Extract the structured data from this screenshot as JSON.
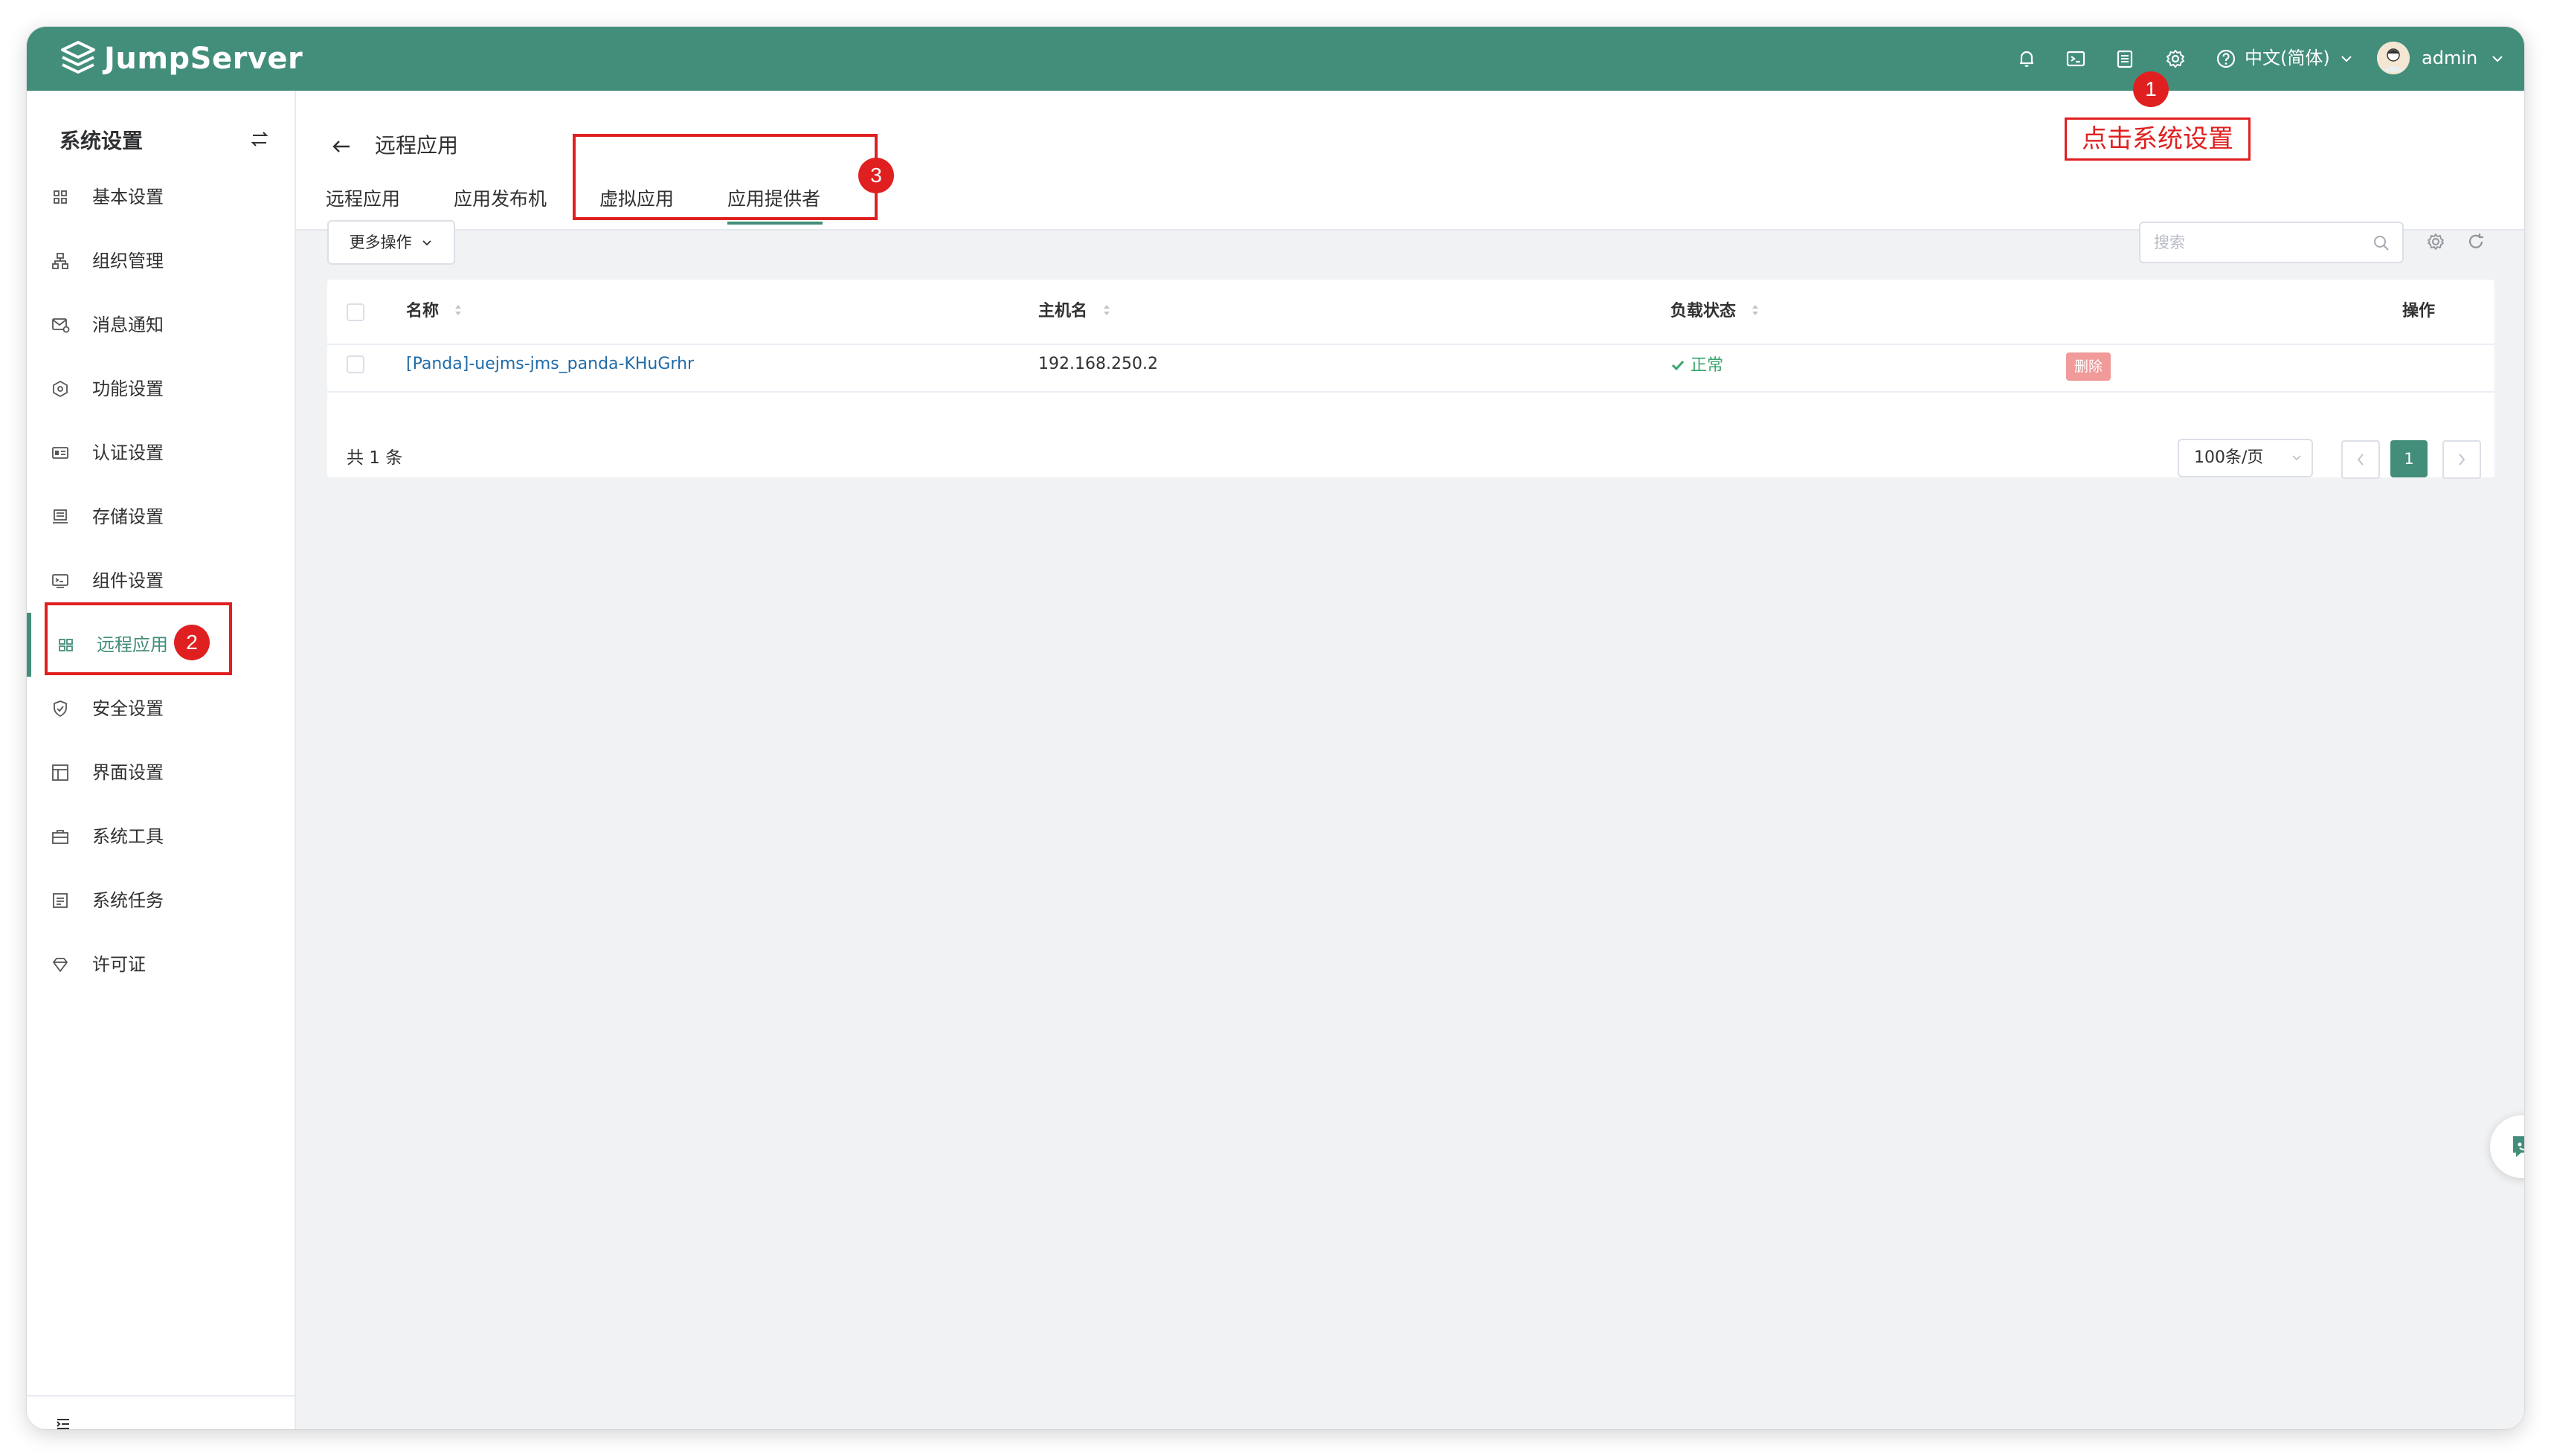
{
  "header": {
    "brand": "JumpServer",
    "language": "中文(简体)",
    "user": "admin",
    "icons": [
      "bell-icon",
      "terminal-icon",
      "document-icon",
      "gear-icon",
      "help-icon"
    ],
    "color": "#438e7b"
  },
  "sidebar": {
    "title": "系统设置",
    "items": [
      {
        "label": "基本设置",
        "icon": "grid-icon"
      },
      {
        "label": "组织管理",
        "icon": "org-icon"
      },
      {
        "label": "消息通知",
        "icon": "message-icon"
      },
      {
        "label": "功能设置",
        "icon": "feature-icon"
      },
      {
        "label": "认证设置",
        "icon": "id-card-icon"
      },
      {
        "label": "存储设置",
        "icon": "storage-icon"
      },
      {
        "label": "组件设置",
        "icon": "component-icon"
      },
      {
        "label": "远程应用",
        "icon": "app-grid-icon",
        "active": true
      },
      {
        "label": "安全设置",
        "icon": "shield-icon"
      },
      {
        "label": "界面设置",
        "icon": "layout-icon"
      },
      {
        "label": "系统工具",
        "icon": "toolbox-icon"
      },
      {
        "label": "系统任务",
        "icon": "task-icon"
      },
      {
        "label": "许可证",
        "icon": "diamond-icon"
      }
    ]
  },
  "page": {
    "title": "远程应用",
    "tabs": [
      "远程应用",
      "应用发布机",
      "虚拟应用",
      "应用提供者"
    ],
    "active_tab": "应用提供者"
  },
  "annotations": {
    "callout": "点击系统设置",
    "badges": [
      "1",
      "2",
      "3"
    ]
  },
  "toolbar": {
    "more_actions": "更多操作",
    "search_placeholder": "搜索"
  },
  "table": {
    "columns": [
      "名称",
      "主机名",
      "负载状态",
      "操作"
    ],
    "rows": [
      {
        "name": "[Panda]-uejms-jms_panda-KHuGrhr",
        "hostname": "192.168.250.2",
        "status": "正常",
        "action": "删除"
      }
    ]
  },
  "pagination": {
    "total": "共 1 条",
    "page_size": "100条/页",
    "current_page": "1"
  }
}
